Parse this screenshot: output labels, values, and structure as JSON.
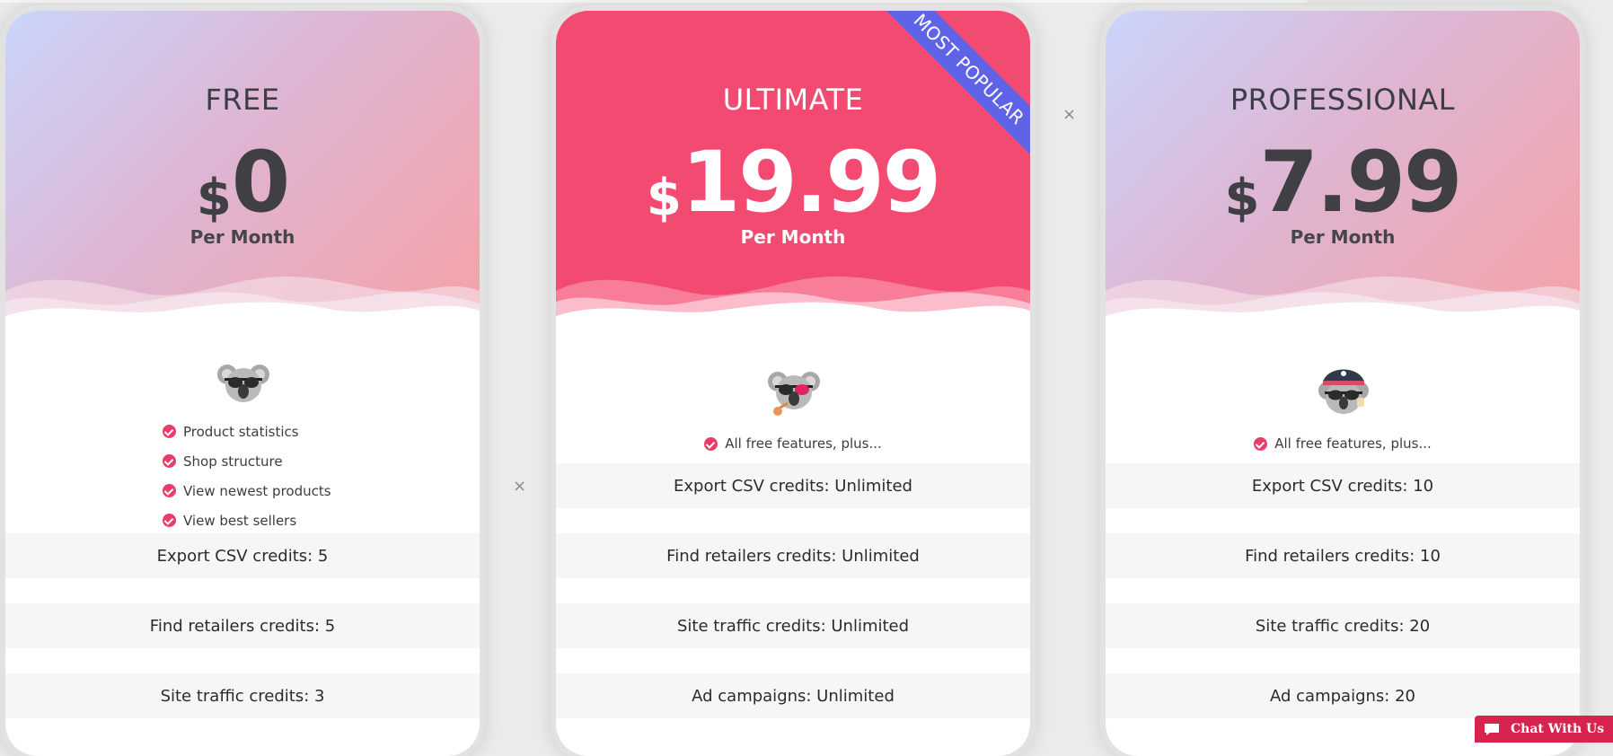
{
  "plans": [
    {
      "name": "FREE",
      "currency": "$",
      "price": "0",
      "period": "Per Month",
      "features": [
        "Product statistics",
        "Shop structure",
        "View newest products",
        "View best sellers"
      ],
      "rows": [
        "Export CSV credits: 5",
        "Find retailers credits: 5",
        "Site traffic credits: 3"
      ]
    },
    {
      "name": "ULTIMATE",
      "currency": "$",
      "price": "19.99",
      "period": "Per Month",
      "badge": "MOST POPULAR",
      "features": [
        "All free features, plus..."
      ],
      "rows": [
        "Export CSV credits: Unlimited",
        "Find retailers credits: Unlimited",
        "Site traffic credits: Unlimited",
        "Ad campaigns: Unlimited"
      ]
    },
    {
      "name": "PROFESSIONAL",
      "currency": "$",
      "price": "7.99",
      "period": "Per Month",
      "features": [
        "All free features, plus..."
      ],
      "rows": [
        "Export CSV credits: 10",
        "Find retailers credits: 10",
        "Site traffic credits: 20",
        "Ad campaigns: 20"
      ]
    }
  ],
  "close_symbol": "×",
  "chat": {
    "label": "Chat With Us"
  },
  "colors": {
    "accent_pink": "#f34a72",
    "badge": "#5f63e8",
    "check": "#ea3c68",
    "chat": "#d9234f"
  },
  "icons": {
    "koala_free": "koala-glasses-icon",
    "koala_ultimate": "koala-pirate-pipe-icon",
    "koala_professional": "koala-pirate-hat-icon",
    "check": "check-circle-icon",
    "chat": "chat-bubble-icon"
  }
}
